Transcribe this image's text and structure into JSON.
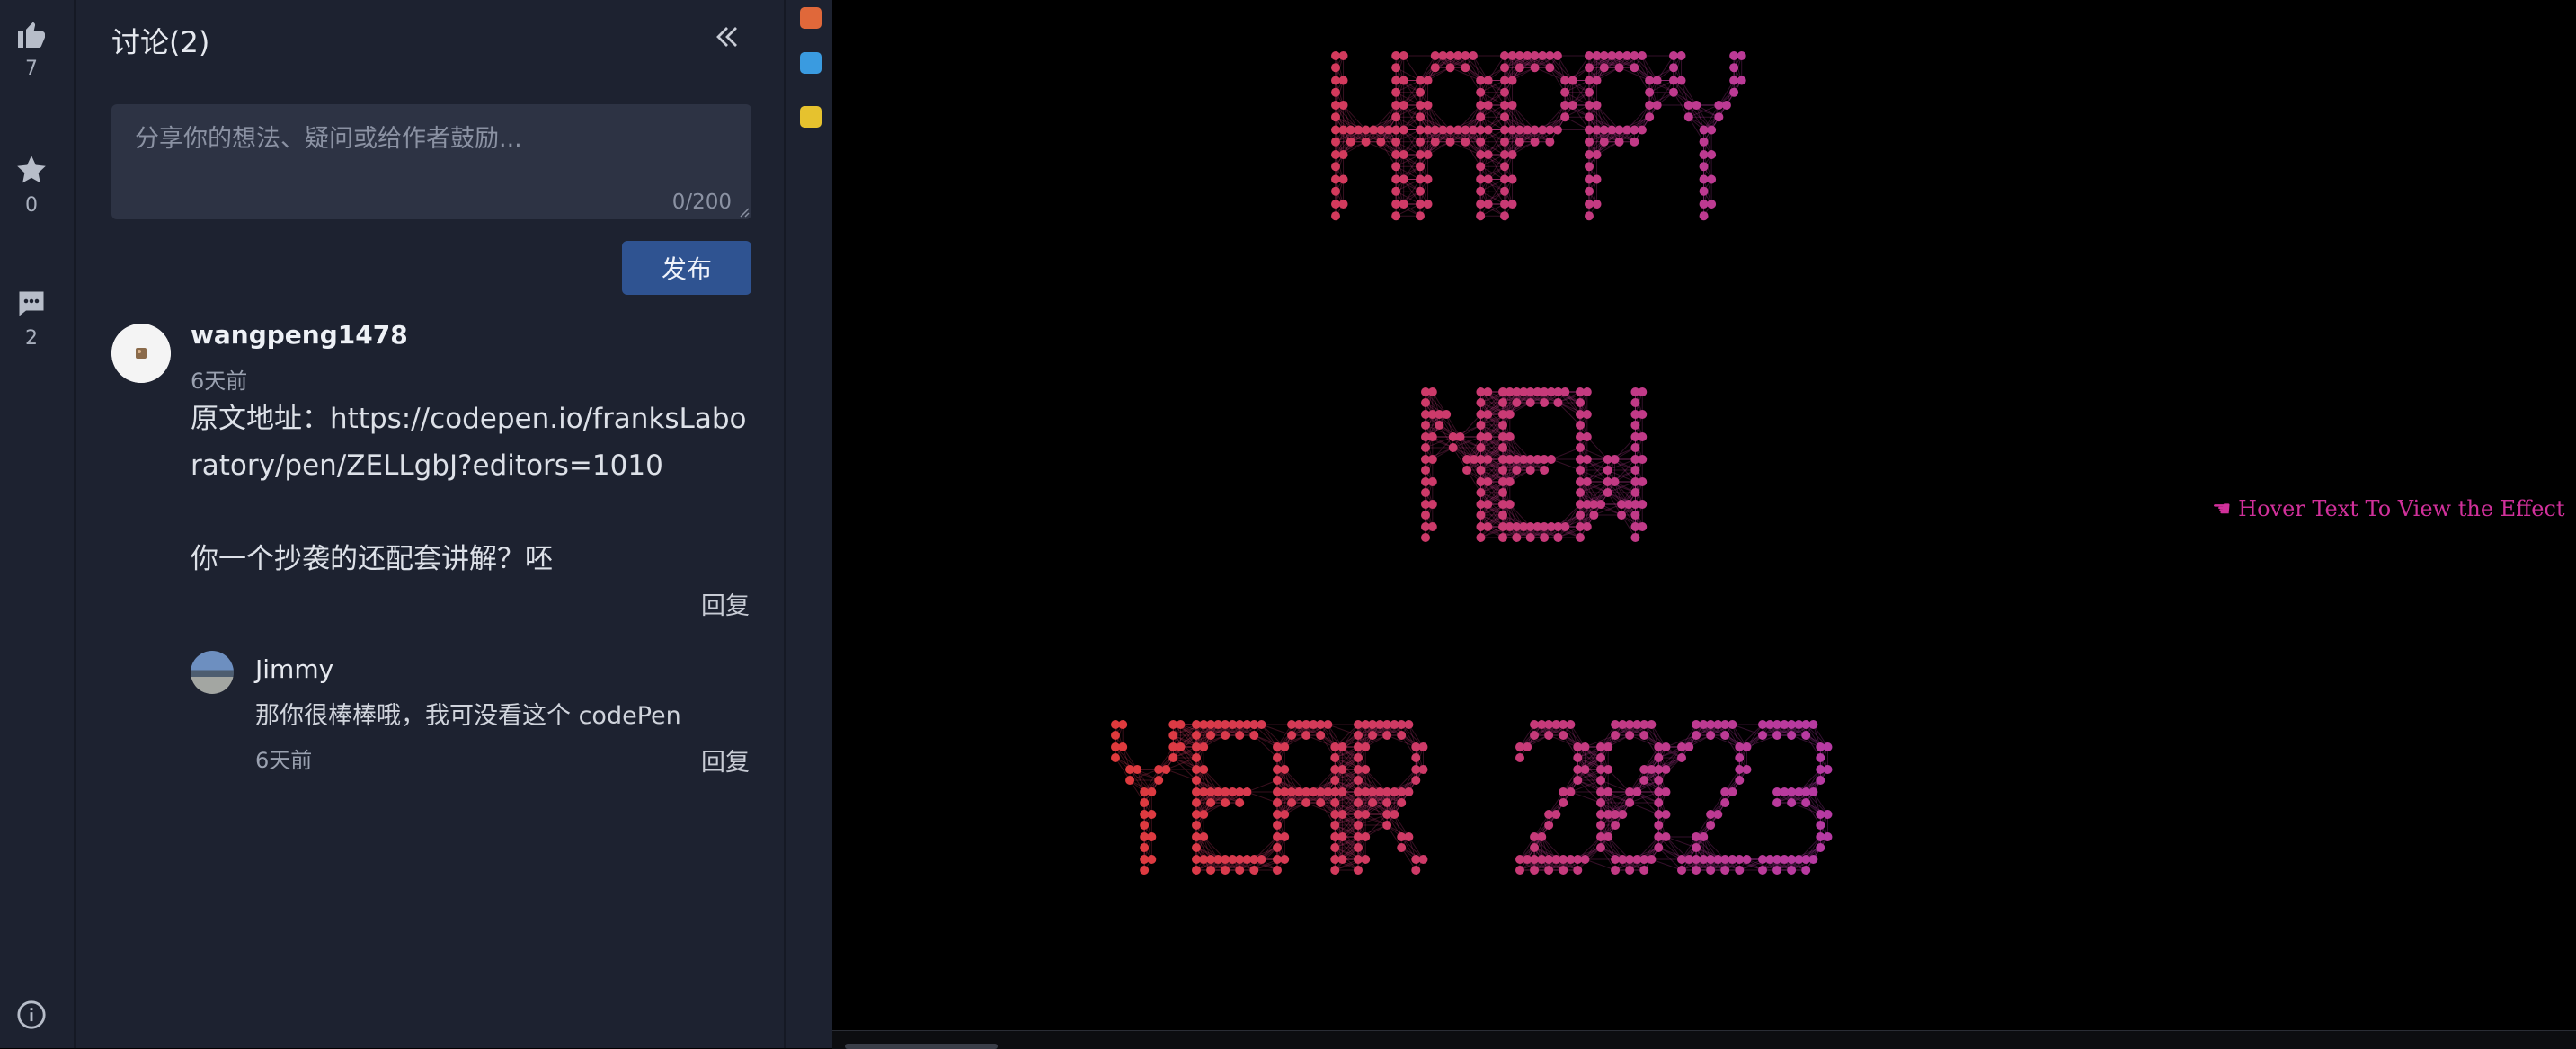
{
  "rail": {
    "like_count": "7",
    "star_count": "0",
    "comment_count": "2"
  },
  "panel": {
    "title": "讨论(2)",
    "input_placeholder": "分享你的想法、疑问或给作者鼓励...",
    "char_count": "0/200",
    "publish_label": "发布"
  },
  "comments": [
    {
      "user": "wangpeng1478",
      "time": "6天前",
      "body_line1": "原文地址：https://codepen.io/franksLaboratory/pen/ZELLgbJ?editors=1010",
      "body_line2": "你一个抄袭的还配套讲解？呸",
      "reply_label": "回复",
      "replies": [
        {
          "user": "Jimmy",
          "text": "那你很棒棒哦，我可没看这个 codePen",
          "time": "6天前",
          "reply_label": "回复"
        }
      ]
    }
  ],
  "canvas": {
    "hint": "☚ Hover Text To View the Effect",
    "text_lines": [
      "HAPPY",
      "NEW",
      "YEAR 2023"
    ],
    "colors": {
      "start": "#e03a3a",
      "end": "#a23ad6"
    }
  }
}
